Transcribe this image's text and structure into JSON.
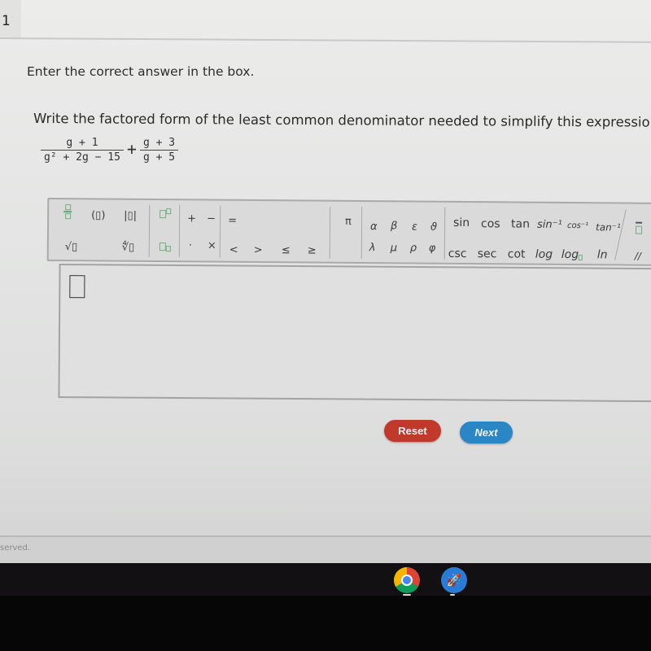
{
  "question": {
    "number": "1",
    "instruction": "Enter the correct answer in the box.",
    "prompt": "Write the factored form of the least common denominator needed to simplify this expression.",
    "expression": {
      "frac1": {
        "numerator": "g + 1",
        "denominator": "g² + 2g − 15"
      },
      "operator": "+",
      "frac2": {
        "numerator": "g + 3",
        "denominator": "g + 5"
      }
    }
  },
  "toolbar": {
    "group1": {
      "fraction": "fraction",
      "parens": "(▯)",
      "abs": "|▯|",
      "sqrt": "√▯",
      "nthroot": "∜▯"
    },
    "group2": {
      "superscript": "▯▯",
      "subscript": "▯▯"
    },
    "group3": {
      "plus": "+",
      "minus": "−",
      "dot": "·",
      "times": "×"
    },
    "group4": {
      "equals": "=",
      "lt": "<",
      "gt": ">",
      "le": "≤",
      "ge": "≥"
    },
    "group5": {
      "pi": "π"
    },
    "group6": {
      "alpha": "α",
      "beta": "β",
      "epsilon": "ε",
      "theta": "ϑ",
      "lambda": "λ",
      "mu": "μ",
      "rho": "ρ",
      "phi": "φ"
    },
    "group7": {
      "sin": "sin",
      "cos": "cos",
      "tan": "tan",
      "asin": "sin⁻¹",
      "acos": "cos⁻¹",
      "atan": "tan⁻¹",
      "csc": "csc",
      "sec": "sec",
      "cot": "cot",
      "log": "log",
      "logn": "log",
      "ln": "ln"
    },
    "group8": {
      "overline": "▯̄",
      "parallel": "//"
    }
  },
  "answer": {
    "value": ""
  },
  "buttons": {
    "reset": "Reset",
    "next": "Next"
  },
  "footer": {
    "text": "served."
  },
  "colors": {
    "reset": "#c0392b",
    "next": "#2b86c5",
    "placeholder_green": "#5aa870"
  },
  "shelf": {
    "apps": [
      "chrome-icon",
      "rocket-app-icon"
    ]
  }
}
